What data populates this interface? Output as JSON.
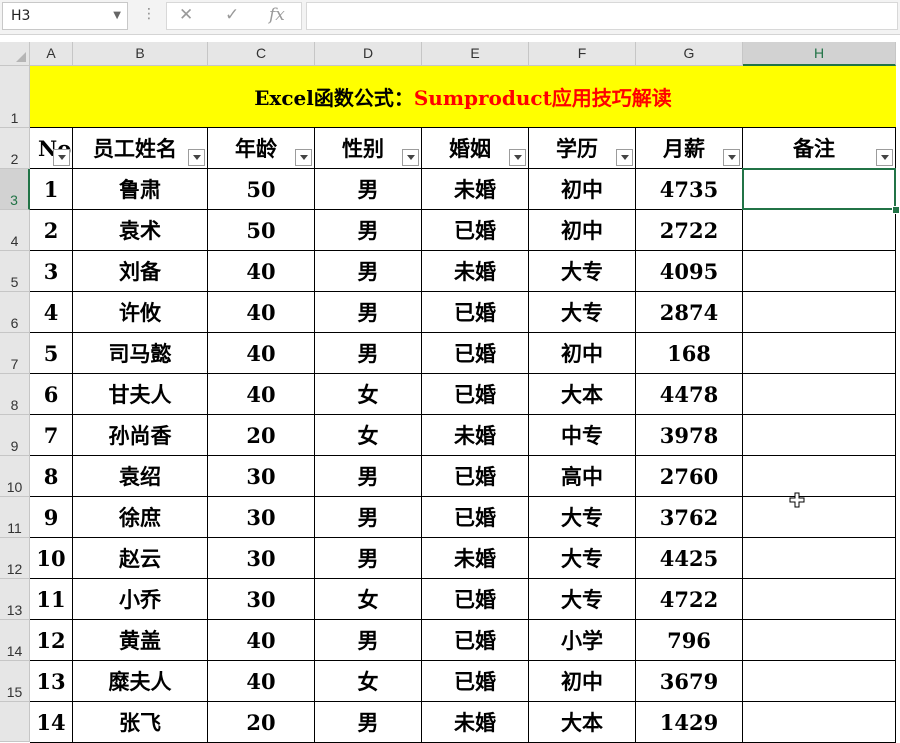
{
  "name_box": {
    "value": "H3"
  },
  "formula_bar": {
    "cancel_icon": "✕",
    "enter_icon": "✓",
    "fx_label": "fx",
    "value": ""
  },
  "column_headers": [
    "A",
    "B",
    "C",
    "D",
    "E",
    "F",
    "G",
    "H"
  ],
  "row_numbers": [
    "1",
    "2",
    "3",
    "4",
    "5",
    "6",
    "7",
    "8",
    "9",
    "10",
    "11",
    "12",
    "13",
    "14",
    "15"
  ],
  "selected_cell": "H3",
  "title": {
    "part1": "Excel函数公式：",
    "part2": "Sumproduct应用技巧解读"
  },
  "table_headers": [
    "No",
    "员工姓名",
    "年龄",
    "性别",
    "婚姻",
    "学历",
    "月薪",
    "备注"
  ],
  "table_rows": [
    [
      "1",
      "鲁肃",
      "50",
      "男",
      "未婚",
      "初中",
      "4735",
      ""
    ],
    [
      "2",
      "袁术",
      "50",
      "男",
      "已婚",
      "初中",
      "2722",
      ""
    ],
    [
      "3",
      "刘备",
      "40",
      "男",
      "未婚",
      "大专",
      "4095",
      ""
    ],
    [
      "4",
      "许攸",
      "40",
      "男",
      "已婚",
      "大专",
      "2874",
      ""
    ],
    [
      "5",
      "司马懿",
      "40",
      "男",
      "已婚",
      "初中",
      "168",
      ""
    ],
    [
      "6",
      "甘夫人",
      "40",
      "女",
      "已婚",
      "大本",
      "4478",
      ""
    ],
    [
      "7",
      "孙尚香",
      "20",
      "女",
      "未婚",
      "中专",
      "3978",
      ""
    ],
    [
      "8",
      "袁绍",
      "30",
      "男",
      "已婚",
      "高中",
      "2760",
      ""
    ],
    [
      "9",
      "徐庶",
      "30",
      "男",
      "已婚",
      "大专",
      "3762",
      ""
    ],
    [
      "10",
      "赵云",
      "30",
      "男",
      "未婚",
      "大专",
      "4425",
      ""
    ],
    [
      "11",
      "小乔",
      "30",
      "女",
      "已婚",
      "大专",
      "4722",
      ""
    ],
    [
      "12",
      "黄盖",
      "40",
      "男",
      "已婚",
      "小学",
      "796",
      ""
    ],
    [
      "13",
      "糜夫人",
      "40",
      "女",
      "已婚",
      "初中",
      "3679",
      ""
    ],
    [
      "14",
      "张飞",
      "20",
      "男",
      "未婚",
      "大本",
      "1429",
      ""
    ]
  ],
  "colors": {
    "title_bg": "#ffff00",
    "title_accent": "#ff0000",
    "selection": "#217346"
  }
}
